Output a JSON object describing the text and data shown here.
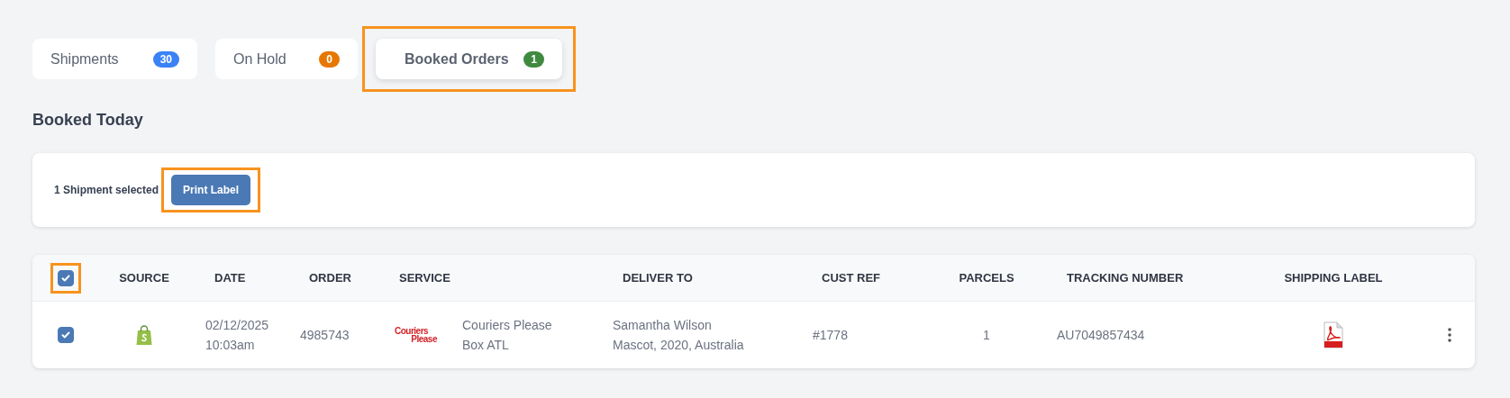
{
  "tabs": [
    {
      "label": "Shipments",
      "count": "30",
      "color": "#3b82f6",
      "selected": false,
      "highlighted": false
    },
    {
      "label": "On Hold",
      "count": "0",
      "color": "#e67700",
      "selected": false,
      "highlighted": false
    },
    {
      "label": "Booked Orders",
      "count": "1",
      "color": "#3f8a3f",
      "selected": true,
      "highlighted": true
    }
  ],
  "section_title": "Booked Today",
  "selection_bar": {
    "summary": "1 Shipment selected",
    "button": {
      "label": "Print Label",
      "highlighted": true
    }
  },
  "table": {
    "select_all": {
      "checked": true,
      "highlighted": true
    },
    "columns": [
      "SOURCE",
      "DATE",
      "ORDER",
      "SERVICE",
      "DELIVER TO",
      "CUST REF",
      "PARCELS",
      "TRACKING NUMBER",
      "SHIPPING LABEL"
    ],
    "rows": [
      {
        "checked": true,
        "date": [
          "02/12/2025",
          "10:03am"
        ],
        "order": "4985743",
        "service_logo": [
          "Couriers",
          "Please"
        ],
        "service": [
          "Couriers Please",
          "Box ATL"
        ],
        "deliver_to": [
          "Samantha Wilson",
          "Mascot, 2020, Australia"
        ],
        "cust_ref": "#1778",
        "parcels": "1",
        "tracking_number": "AU7049857434"
      }
    ]
  }
}
